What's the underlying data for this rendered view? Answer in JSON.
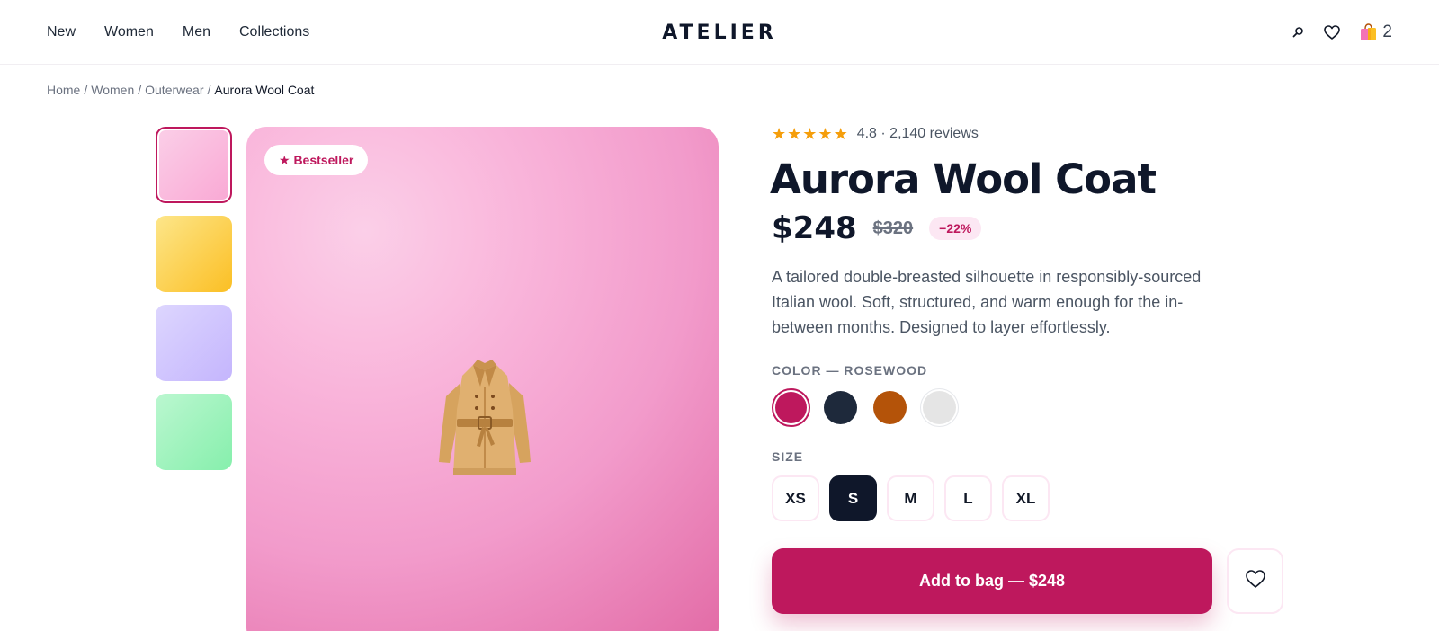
{
  "header": {
    "nav": [
      "New",
      "Women",
      "Men",
      "Collections"
    ],
    "logo": "ATELIER",
    "icons": [
      "search-icon",
      "heart-icon",
      "shopping-bag-icon"
    ],
    "cart_count": "2"
  },
  "breadcrumb": {
    "items": [
      "Home",
      "Women",
      "Outerwear"
    ],
    "current": "Aurora Wool Coat",
    "separator": "/"
  },
  "gallery": {
    "thumbnails": [
      "pink",
      "yellow",
      "lilac",
      "green"
    ],
    "active_thumbnail": 0,
    "badge": "★ Bestseller",
    "image_icon": "coat-icon"
  },
  "product": {
    "rating_stars": 5,
    "rating_text": "4.8 · 2,140 reviews",
    "title": "Aurora Wool Coat",
    "price": "$248",
    "old_price": "$320",
    "discount": "−22%",
    "description": "A tailored double-breasted silhouette in responsibly-sourced Italian wool. Soft, structured, and warm enough for the in-between months. Designed to layer effortlessly."
  },
  "color": {
    "label": "COLOR — ROSEWOOD",
    "options": [
      "#be185d",
      "#1e293b",
      "#b45309",
      "#e5e5e5"
    ],
    "selected": 0
  },
  "size": {
    "label": "SIZE",
    "options": [
      "XS",
      "S",
      "M",
      "L",
      "XL"
    ],
    "selected": "S"
  },
  "actions": {
    "add_to_bag": "Add to bag — $248"
  },
  "colors": {
    "accent": "#be185d",
    "dark": "#0f172a",
    "star": "#f59e0b"
  }
}
